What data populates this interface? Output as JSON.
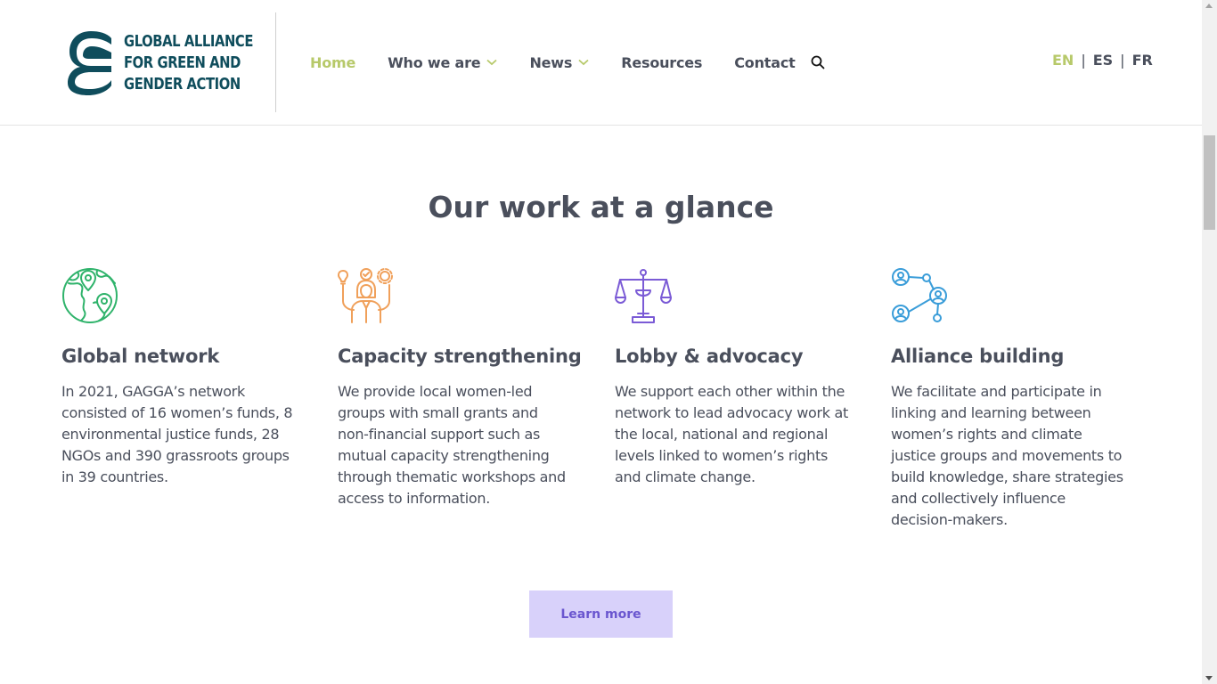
{
  "header": {
    "logo": {
      "lines": [
        "GLOBAL ALLIANCE",
        "FOR GREEN AND",
        "GENDER ACTION"
      ],
      "icon": "gagga-logo-icon"
    },
    "nav": [
      {
        "label": "Home",
        "active": true,
        "dropdown": false
      },
      {
        "label": "Who we are",
        "active": false,
        "dropdown": true
      },
      {
        "label": "News",
        "active": false,
        "dropdown": true
      },
      {
        "label": "Resources",
        "active": false,
        "dropdown": false
      },
      {
        "label": "Contact",
        "active": false,
        "dropdown": false
      }
    ],
    "search_icon": "search-icon",
    "languages": [
      {
        "code": "EN",
        "active": true
      },
      {
        "code": "ES",
        "active": false
      },
      {
        "code": "FR",
        "active": false
      }
    ],
    "lang_separator": "|"
  },
  "main": {
    "title": "Our work at a glance",
    "cards": [
      {
        "icon": "globe-location-icon",
        "title": "Global network",
        "text": "In 2021, GAGGA’s network consisted of 16 women’s funds, 8 environmental justice funds, 28 NGOs and 390 grassroots groups in 39 countries."
      },
      {
        "icon": "woman-ideas-icon",
        "title": "Capacity strengthening",
        "text": "We provide local women-led groups with small grants and non-financial support such as mutual capacity strengthening through thematic workshops and access to information."
      },
      {
        "icon": "scales-icon",
        "title": "Lobby & advocacy",
        "text": "We support each other within the network to lead advocacy work at the local, national and regional levels linked to women’s rights and climate change."
      },
      {
        "icon": "network-people-icon",
        "title": "Alliance building",
        "text": "We facilitate and participate in linking and learning between women’s rights and climate justice groups and movements to build knowledge, share strategies and collectively influence decision-makers."
      }
    ],
    "cta": "Learn more"
  },
  "colors": {
    "brand_teal": "#0f4d5c",
    "accent_green": "#b7c96a",
    "text": "#4a4f5c",
    "globe_icon": "#2fb36b",
    "capacity_icon": "#f0a05a",
    "scales_icon": "#7b5bd6",
    "network_icon": "#3a9dd9",
    "button_bg": "#d8d1fa",
    "button_text": "#6a56cf"
  }
}
